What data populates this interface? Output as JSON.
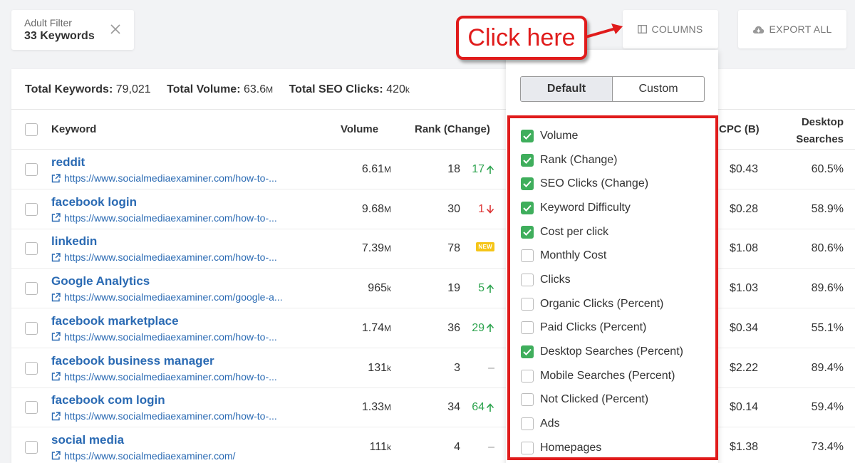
{
  "filter": {
    "label": "Adult Filter",
    "value": "33 Keywords"
  },
  "top_buttons": {
    "columns": "COLUMNS",
    "export": "EXPORT ALL"
  },
  "callout": {
    "text": "Click here"
  },
  "totals": {
    "keywords_label": "Total Keywords:",
    "keywords_value": "79,021",
    "volume_label": "Total Volume:",
    "volume_value": "63.6",
    "volume_unit": "M",
    "clicks_label": "Total SEO Clicks:",
    "clicks_value": "420",
    "clicks_unit": "k"
  },
  "table": {
    "headers": {
      "keyword": "Keyword",
      "volume": "Volume",
      "rank": "Rank (Change)",
      "cpc": "CPC (B)",
      "desktop_line1": "Desktop",
      "desktop_line2": "Searches"
    },
    "rows": [
      {
        "keyword": "reddit",
        "url": "https://www.socialmediaexaminer.com/how-to-...",
        "volume": "6.61",
        "volume_unit": "M",
        "rank": "18",
        "change": "17",
        "change_dir": "up",
        "cpc": "$0.43",
        "desktop": "60.5%"
      },
      {
        "keyword": "facebook login",
        "url": "https://www.socialmediaexaminer.com/how-to-...",
        "volume": "9.68",
        "volume_unit": "M",
        "rank": "30",
        "change": "1",
        "change_dir": "down",
        "cpc": "$0.28",
        "desktop": "58.9%"
      },
      {
        "keyword": "linkedin",
        "url": "https://www.socialmediaexaminer.com/how-to-...",
        "volume": "7.39",
        "volume_unit": "M",
        "rank": "78",
        "change": "NEW",
        "change_dir": "new",
        "cpc": "$1.08",
        "desktop": "80.6%"
      },
      {
        "keyword": "Google Analytics",
        "url": "https://www.socialmediaexaminer.com/google-a...",
        "volume": "965",
        "volume_unit": "k",
        "rank": "19",
        "change": "5",
        "change_dir": "up",
        "cpc": "$1.03",
        "desktop": "89.6%"
      },
      {
        "keyword": "facebook marketplace",
        "url": "https://www.socialmediaexaminer.com/how-to-...",
        "volume": "1.74",
        "volume_unit": "M",
        "rank": "36",
        "change": "29",
        "change_dir": "up",
        "cpc": "$0.34",
        "desktop": "55.1%"
      },
      {
        "keyword": "facebook business manager",
        "url": "https://www.socialmediaexaminer.com/how-to-...",
        "volume": "131",
        "volume_unit": "k",
        "rank": "3",
        "change": "–",
        "change_dir": "none",
        "cpc": "$2.22",
        "desktop": "89.4%"
      },
      {
        "keyword": "facebook com login",
        "url": "https://www.socialmediaexaminer.com/how-to-...",
        "volume": "1.33",
        "volume_unit": "M",
        "rank": "34",
        "change": "64",
        "change_dir": "up",
        "cpc": "$0.14",
        "desktop": "59.4%"
      },
      {
        "keyword": "social media",
        "url": "https://www.socialmediaexaminer.com/",
        "volume": "111",
        "volume_unit": "k",
        "rank": "4",
        "change": "–",
        "change_dir": "none",
        "cpc": "$1.38",
        "desktop": "73.4%"
      }
    ]
  },
  "columns_dropdown": {
    "tabs": {
      "default": "Default",
      "custom": "Custom"
    },
    "options": [
      {
        "label": "Volume",
        "checked": true
      },
      {
        "label": "Rank (Change)",
        "checked": true
      },
      {
        "label": "SEO Clicks (Change)",
        "checked": true
      },
      {
        "label": "Keyword Difficulty",
        "checked": true
      },
      {
        "label": "Cost per click",
        "checked": true
      },
      {
        "label": "Monthly Cost",
        "checked": false
      },
      {
        "label": "Clicks",
        "checked": false
      },
      {
        "label": "Organic Clicks (Percent)",
        "checked": false
      },
      {
        "label": "Paid Clicks (Percent)",
        "checked": false
      },
      {
        "label": "Desktop Searches (Percent)",
        "checked": true
      },
      {
        "label": "Mobile Searches (Percent)",
        "checked": false
      },
      {
        "label": "Not Clicked (Percent)",
        "checked": false
      },
      {
        "label": "Ads",
        "checked": false
      },
      {
        "label": "Homepages",
        "checked": false
      }
    ]
  },
  "colors": {
    "accent_blue": "#2a6ab3",
    "check_green": "#3fae5c",
    "up_green": "#2ea44f",
    "down_red": "#d33",
    "callout_red": "#e01b1b",
    "new_yellow": "#f5c518"
  }
}
